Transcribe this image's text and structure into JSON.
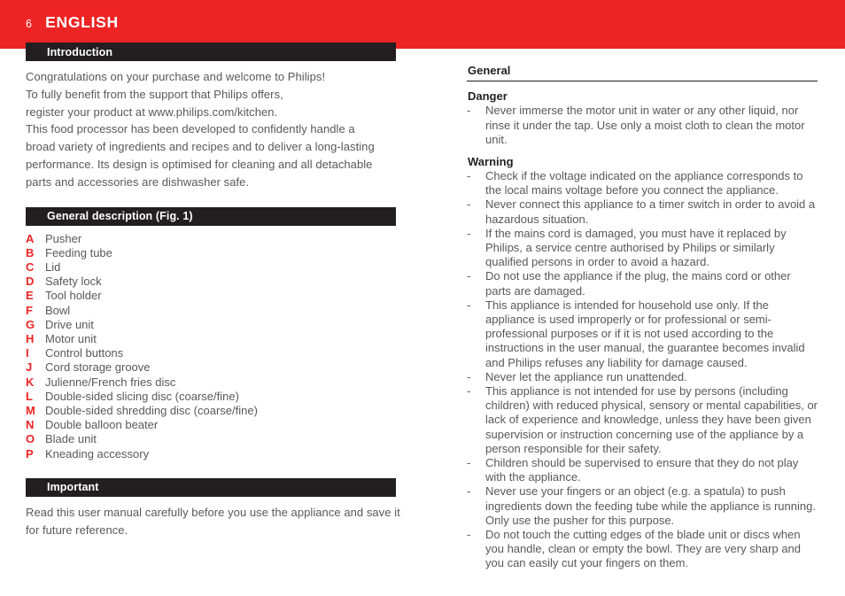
{
  "theme": {
    "brand_red": "#ED2424",
    "bar_black": "#231F20",
    "body_gray": "#59595B"
  },
  "header": {
    "page_number": "6",
    "language_title": "ENGLISH"
  },
  "left_column": {
    "introduction": {
      "bar_label": "Introduction",
      "lines": [
        "Congratulations on your purchase and welcome to Philips!",
        "To fully benefit from the support that Philips offers,",
        "register your product at www.philips.com/kitchen.",
        "This food processor has been developed to confidently handle a",
        "broad variety of ingredients and recipes and to deliver a long-lasting",
        "performance. Its design is optimised for cleaning and all detachable",
        "parts and accessories are dishwasher safe."
      ]
    },
    "general_description": {
      "bar_label": "General description (Fig. 1)",
      "items": [
        {
          "key": "A",
          "label": "Pusher"
        },
        {
          "key": "B",
          "label": "Feeding tube"
        },
        {
          "key": "C",
          "label": "Lid"
        },
        {
          "key": "D",
          "label": "Safety lock"
        },
        {
          "key": "E",
          "label": "Tool holder"
        },
        {
          "key": "F",
          "label": "Bowl"
        },
        {
          "key": "G",
          "label": "Drive unit"
        },
        {
          "key": "H",
          "label": "Motor unit"
        },
        {
          "key": "I",
          "label": "Control buttons"
        },
        {
          "key": "J",
          "label": "Cord storage groove"
        },
        {
          "key": "K",
          "label": "Julienne/French fries disc"
        },
        {
          "key": "L",
          "label": "Double-sided slicing disc (coarse/fine)"
        },
        {
          "key": "M",
          "label": "Double-sided shredding disc (coarse/fine)"
        },
        {
          "key": "N",
          "label": "Double balloon beater"
        },
        {
          "key": "O",
          "label": "Blade unit"
        },
        {
          "key": "P",
          "label": "Kneading accessory"
        }
      ]
    },
    "important": {
      "bar_label": "Important",
      "lines": [
        "Read this user manual carefully before you use the appliance and save it",
        "for future reference."
      ]
    }
  },
  "right_column": {
    "general_heading": "General",
    "danger": {
      "heading": "Danger",
      "bullet_marker": "-",
      "items": [
        "Never immerse the motor unit in water or any other liquid, nor rinse it under the tap. Use only a moist cloth to clean the motor unit."
      ]
    },
    "warning": {
      "heading": "Warning",
      "bullet_marker": "-",
      "items": [
        "Check if the voltage indicated on the appliance corresponds to the local mains voltage before you connect the appliance.",
        "Never connect this appliance to a timer switch in order to avoid a hazardous situation.",
        "If the mains cord is damaged, you must have it replaced by Philips, a service centre authorised by Philips or similarly qualified persons in order to avoid a hazard.",
        "Do not use the appliance if the plug, the mains cord or other parts are damaged.",
        "This appliance is intended for household use only. If the appliance is used improperly or for professional or semi-professional purposes or if it is not used according to the instructions in the user manual, the guarantee becomes invalid and Philips refuses any liability for damage caused.",
        "Never let the appliance run unattended.",
        "This appliance is not intended for use by persons (including children) with reduced physical, sensory or mental capabilities, or lack of experience and knowledge, unless they have been given supervision or instruction concerning use of the appliance by a person responsible for their safety.",
        "Children should be supervised to ensure that they do not play with the appliance.",
        "Never use your fingers or an object (e.g. a spatula) to push ingredients down the feeding tube while the appliance is running. Only use the pusher for this purpose.",
        "Do not touch the cutting edges of the blade unit or discs when you handle, clean or empty the bowl. They are very sharp and you can easily cut your fingers on them."
      ]
    }
  }
}
